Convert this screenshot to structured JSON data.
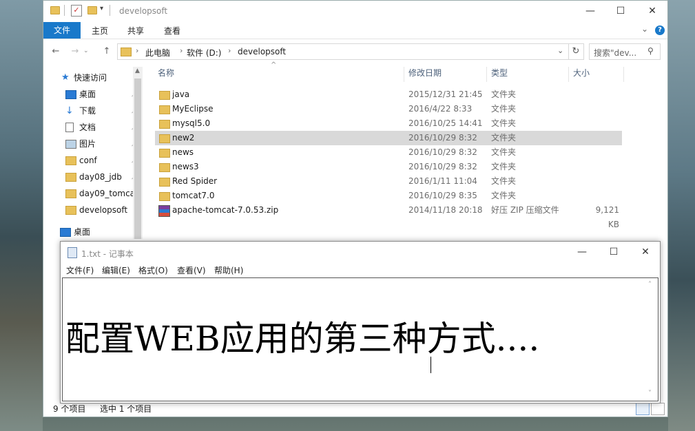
{
  "explorer": {
    "title": "developsoft",
    "controls": {
      "minimize": "—",
      "maximize": "☐",
      "close": "✕"
    },
    "ribbon": {
      "file": "文件",
      "tabs": [
        "主页",
        "共享",
        "查看"
      ],
      "expand": "⌄",
      "help": "?"
    },
    "nav": {
      "back": "←",
      "forward": "→",
      "up": "↑"
    },
    "address": {
      "crumbs": [
        "此电脑",
        "软件 (D:)",
        "developsoft"
      ],
      "dropdown": "⌄",
      "refresh": "↻"
    },
    "search": {
      "placeholder": "搜索\"dev..."
    },
    "sidebar": {
      "quick_access": "快速访问",
      "items": [
        {
          "label": "桌面",
          "icon": "desktop-icon",
          "pinned": true
        },
        {
          "label": "下载",
          "icon": "download-icon",
          "pinned": true
        },
        {
          "label": "文档",
          "icon": "document-icon",
          "pinned": true
        },
        {
          "label": "图片",
          "icon": "picture-icon",
          "pinned": true
        },
        {
          "label": "conf",
          "icon": "folder-icon",
          "pinned": true
        },
        {
          "label": "day08_jdb",
          "icon": "folder-icon",
          "pinned": true
        },
        {
          "label": "day09_tomca",
          "icon": "folder-icon",
          "pinned": false
        },
        {
          "label": "developsoft",
          "icon": "folder-icon",
          "pinned": false
        }
      ],
      "desktop": "桌面"
    },
    "columns": {
      "name": "名称",
      "modified": "修改日期",
      "type": "类型",
      "size": "大小"
    },
    "files": [
      {
        "name": "java",
        "modified": "2015/12/31 21:45",
        "type": "文件夹",
        "size": "",
        "icon": "folder-icon"
      },
      {
        "name": "MyEclipse",
        "modified": "2016/4/22 8:33",
        "type": "文件夹",
        "size": "",
        "icon": "folder-icon"
      },
      {
        "name": "mysql5.0",
        "modified": "2016/10/25 14:41",
        "type": "文件夹",
        "size": "",
        "icon": "folder-icon"
      },
      {
        "name": "new2",
        "modified": "2016/10/29 8:32",
        "type": "文件夹",
        "size": "",
        "icon": "folder-icon",
        "selected": true
      },
      {
        "name": "news",
        "modified": "2016/10/29 8:32",
        "type": "文件夹",
        "size": "",
        "icon": "folder-icon"
      },
      {
        "name": "news3",
        "modified": "2016/10/29 8:32",
        "type": "文件夹",
        "size": "",
        "icon": "folder-icon"
      },
      {
        "name": "Red Spider",
        "modified": "2016/1/11 11:04",
        "type": "文件夹",
        "size": "",
        "icon": "folder-icon"
      },
      {
        "name": "tomcat7.0",
        "modified": "2016/10/29 8:35",
        "type": "文件夹",
        "size": "",
        "icon": "folder-icon"
      },
      {
        "name": "apache-tomcat-7.0.53.zip",
        "modified": "2014/11/18 20:18",
        "type": "好压 ZIP 压缩文件",
        "size": "9,121 KB",
        "icon": "zip-archive-icon"
      }
    ],
    "status": {
      "count": "9 个项目",
      "selected": "选中 1 个项目"
    }
  },
  "notepad": {
    "title": "1.txt - 记事本",
    "controls": {
      "minimize": "—",
      "maximize": "☐",
      "close": "✕"
    },
    "menu": [
      "文件(F)",
      "编辑(E)",
      "格式(O)",
      "查看(V)",
      "帮助(H)"
    ],
    "content": "配置WEB应用的第三种方式....",
    "scroll_up": "˄",
    "scroll_down": "˅"
  },
  "colors": {
    "accent": "#1979ca",
    "selection": "#d9d9d9",
    "folder": "#e8c15a"
  }
}
